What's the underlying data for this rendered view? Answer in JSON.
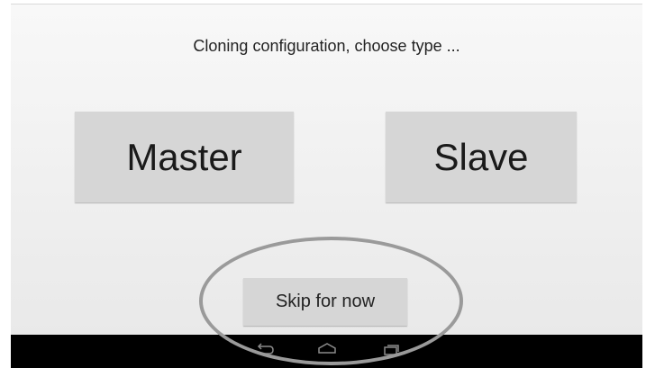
{
  "prompt": "Cloning configuration, choose type ...",
  "buttons": {
    "master": "Master",
    "slave": "Slave",
    "skip": "Skip for now"
  },
  "navbar": {
    "icons": [
      "back-icon",
      "home-icon",
      "recent-apps-icon"
    ]
  },
  "colors": {
    "button_bg": "#d6d6d6",
    "screen_bg": "#f2f2f2",
    "navbar_bg": "#000000",
    "highlight_ring": "#9a9a9a"
  }
}
